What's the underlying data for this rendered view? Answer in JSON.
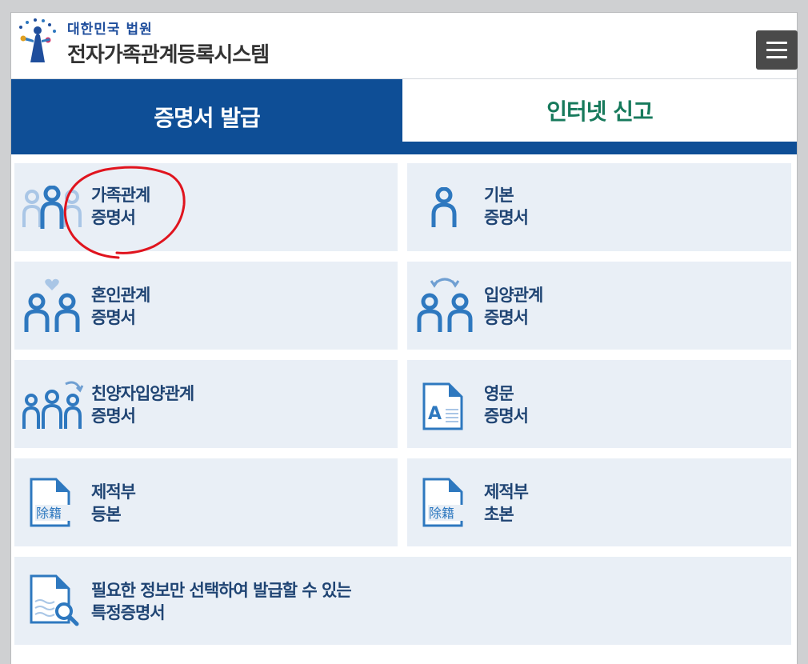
{
  "header": {
    "court_name": "대한민국 법원",
    "system_name": "전자가족관계등록시스템"
  },
  "tabs": [
    {
      "label": "증명서 발급",
      "active": true
    },
    {
      "label": "인터넷 신고",
      "active": false
    }
  ],
  "cards": [
    {
      "line1": "가족관계",
      "line2": "증명서",
      "icon": "family-icon"
    },
    {
      "line1": "기본",
      "line2": "증명서",
      "icon": "person-icon"
    },
    {
      "line1": "혼인관계",
      "line2": "증명서",
      "icon": "couple-heart-icon"
    },
    {
      "line1": "입양관계",
      "line2": "증명서",
      "icon": "adoption-icon"
    },
    {
      "line1": "친양자입양관계",
      "line2": "증명서",
      "icon": "adoption-family-icon"
    },
    {
      "line1": "영문",
      "line2": "증명서",
      "icon": "english-document-icon"
    },
    {
      "line1": "제적부",
      "line2": "등본",
      "icon": "removed-register-document-icon"
    },
    {
      "line1": "제적부",
      "line2": "초본",
      "icon": "removed-register-document-icon"
    },
    {
      "line1": "필요한 정보만 선택하여 발급할 수 있는",
      "line2": "특정증명서",
      "icon": "document-search-icon"
    }
  ],
  "icon_text": {
    "english_letter": "A",
    "removed_register": "除籍"
  },
  "colors": {
    "brand_blue": "#0e4e96",
    "card_bg": "#e9eff6",
    "card_text": "#1f4473",
    "tab_report_green": "#177a5c",
    "icon_blue": "#2e78bf",
    "annotation_red": "#e0141e"
  }
}
